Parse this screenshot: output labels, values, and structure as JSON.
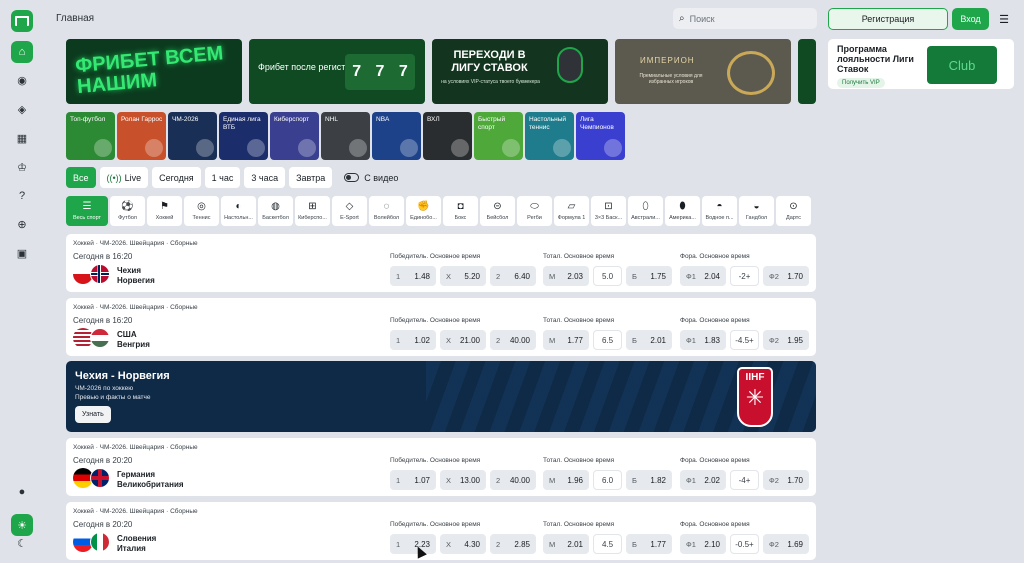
{
  "page": {
    "title": "Главная"
  },
  "search": {
    "placeholder": "Поиск"
  },
  "auth": {
    "register_label": "Регистрация",
    "login_label": "Вход"
  },
  "banners": {
    "b1_text": "ФРИБЕТ ВСЕМ НАШИМ",
    "b2_text": "Фрибет после регистрации",
    "b2_slot": [
      "7",
      "7",
      "7"
    ],
    "b3_title": "ПЕРЕХОДИ В ЛИГУ СТАВОК",
    "b3_sub": "на условиях VIP-статуса твоего букмекера",
    "b4_title": "ИМПЕРИОН",
    "b4_sub": "Премиальные условия для избранных игроков"
  },
  "promo": {
    "title": "Программа лояльности Лиги Ставок",
    "button": "Получить VIP",
    "card_text": "Club"
  },
  "tiles": [
    {
      "label": "Топ-футбол",
      "color": "#2d8a34"
    },
    {
      "label": "Ролан Гаррос",
      "color": "#c8512b"
    },
    {
      "label": "ЧМ-2026",
      "color": "#1a2f55"
    },
    {
      "label": "Единая лига ВТБ",
      "color": "#1c2d6b"
    },
    {
      "label": "Киберспорт",
      "color": "#3a3f8f"
    },
    {
      "label": "NHL",
      "color": "#3c4045"
    },
    {
      "label": "NBA",
      "color": "#1d428a"
    },
    {
      "label": "ВХЛ",
      "color": "#2a2d30"
    },
    {
      "label": "Быстрый спорт",
      "color": "#4ea83a"
    },
    {
      "label": "Настольный теннис",
      "color": "#1e7c8c"
    },
    {
      "label": "Лига Чемпионов",
      "color": "#3b3fd0"
    }
  ],
  "filters": {
    "all": "Все",
    "live": "Live",
    "today": "Сегодня",
    "hour1": "1 час",
    "hours3": "3 часа",
    "tomorrow": "Завтра",
    "video": "С видео"
  },
  "sports": [
    {
      "name": "Весь спорт",
      "icon": "list-icon"
    },
    {
      "name": "Футбол",
      "icon": "football-icon"
    },
    {
      "name": "Хоккей",
      "icon": "hockey-icon"
    },
    {
      "name": "Теннис",
      "icon": "tennis-icon"
    },
    {
      "name": "Настольн...",
      "icon": "table-tennis-icon"
    },
    {
      "name": "Баскетбол",
      "icon": "basketball-icon"
    },
    {
      "name": "Киберспо...",
      "icon": "gamepad-icon"
    },
    {
      "name": "E-Sport",
      "icon": "esport-icon"
    },
    {
      "name": "Волейбол",
      "icon": "volleyball-icon"
    },
    {
      "name": "Единобо...",
      "icon": "fight-icon"
    },
    {
      "name": "Бокс",
      "icon": "boxing-icon"
    },
    {
      "name": "Бейсбол",
      "icon": "baseball-icon"
    },
    {
      "name": "Регби",
      "icon": "rugby-icon"
    },
    {
      "name": "Формула 1",
      "icon": "formula1-icon"
    },
    {
      "name": "3×3 Баск...",
      "icon": "basketball3x3-icon"
    },
    {
      "name": "Австрали...",
      "icon": "australian-football-icon"
    },
    {
      "name": "Америка...",
      "icon": "american-football-icon"
    },
    {
      "name": "Водное п...",
      "icon": "water-polo-icon"
    },
    {
      "name": "Гандбол",
      "icon": "handball-icon"
    },
    {
      "name": "Дартс",
      "icon": "darts-icon"
    }
  ],
  "market_headers": {
    "winner": "Победитель. Основное время",
    "total": "Тотал. Основное время",
    "handicap": "Фора. Основное время"
  },
  "events": [
    {
      "league": "Хоккей · ЧМ-2026. Швейцария · Сборные",
      "time": "Сегодня в 16:20",
      "team1": "Чехия",
      "team2": "Норвегия",
      "flag1": "czech",
      "flag2": "norway",
      "w1": "1.48",
      "x": "5.20",
      "w2": "6.40",
      "tm": "2.03",
      "total": "5.0",
      "tb": "1.75",
      "f1": "2.04",
      "hc": "-2+",
      "f2": "1.70"
    },
    {
      "league": "Хоккей · ЧМ-2026. Швейцария · Сборные",
      "time": "Сегодня в 16:20",
      "team1": "США",
      "team2": "Венгрия",
      "flag1": "usa",
      "flag2": "hungary",
      "w1": "1.02",
      "x": "21.00",
      "w2": "40.00",
      "tm": "1.77",
      "total": "6.5",
      "tb": "2.01",
      "f1": "1.83",
      "hc": "-4.5+",
      "f2": "1.95"
    },
    {
      "league": "Хоккей · ЧМ-2026. Швейцария · Сборные",
      "time": "Сегодня в 20:20",
      "team1": "Германия",
      "team2": "Великобритания",
      "flag1": "germany",
      "flag2": "uk",
      "w1": "1.07",
      "x": "13.00",
      "w2": "40.00",
      "tm": "1.96",
      "total": "6.0",
      "tb": "1.82",
      "f1": "2.02",
      "hc": "-4+",
      "f2": "1.70"
    },
    {
      "league": "Хоккей · ЧМ-2026. Швейцария · Сборные",
      "time": "Сегодня в 20:20",
      "team1": "Словения",
      "team2": "Италия",
      "flag1": "slovenia",
      "flag2": "italy",
      "w1": "2.23",
      "x": "4.30",
      "w2": "2.85",
      "tm": "2.01",
      "total": "4.5",
      "tb": "1.77",
      "f1": "2.10",
      "hc": "-0.5+",
      "f2": "1.69"
    }
  ],
  "odd_keys": {
    "w1": "1",
    "x": "X",
    "w2": "2",
    "tm": "М",
    "tb": "Б",
    "f1": "Ф1",
    "f2": "Ф2"
  },
  "hero": {
    "title": "Чехия - Норвегия",
    "line1": "ЧМ-2026 по хоккею",
    "line2": "Превью и факты о матче",
    "button": "Узнать",
    "logo_text": "IIHF"
  },
  "colors": {
    "accent": "#1fa64a",
    "background": "#dfe3e9",
    "hero": "#0f2a47"
  }
}
